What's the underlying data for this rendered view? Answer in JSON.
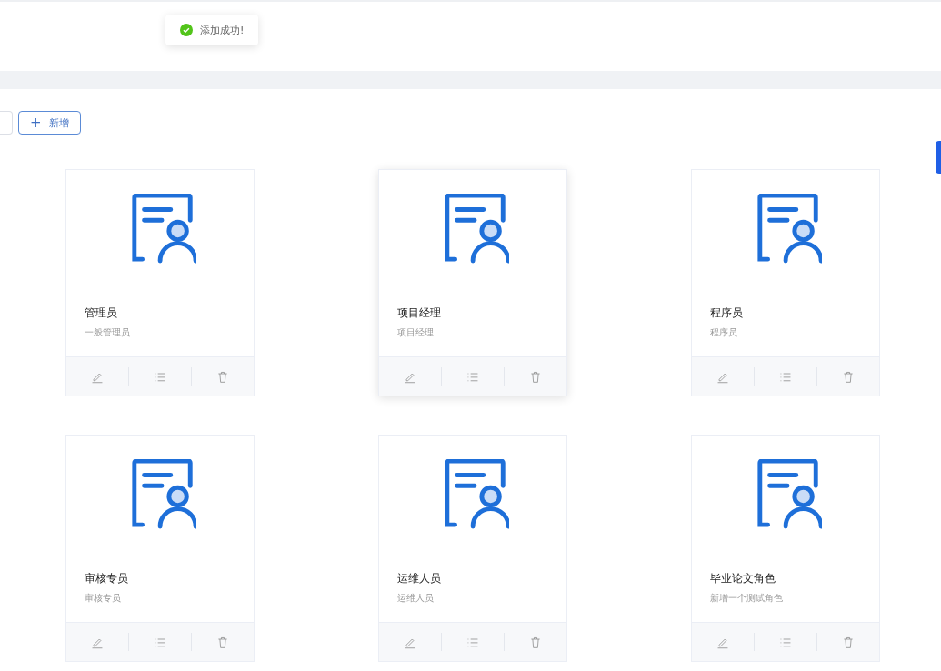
{
  "toast": {
    "kind": "success",
    "text": "添加成功!"
  },
  "toolbar": {
    "add_button": {
      "icon": "+",
      "label": "新增"
    }
  },
  "roles": [
    {
      "name": "管理员",
      "description": "一般管理员",
      "raised": false
    },
    {
      "name": "项目经理",
      "description": "项目经理",
      "raised": true
    },
    {
      "name": "程序员",
      "description": "程序员",
      "raised": false
    },
    {
      "name": "审核专员",
      "description": "审核专员",
      "raised": false
    },
    {
      "name": "运维人员",
      "description": "运维人员",
      "raised": false
    },
    {
      "name": "毕业论文角色",
      "description": "新增一个测试角色",
      "raised": false
    }
  ]
}
